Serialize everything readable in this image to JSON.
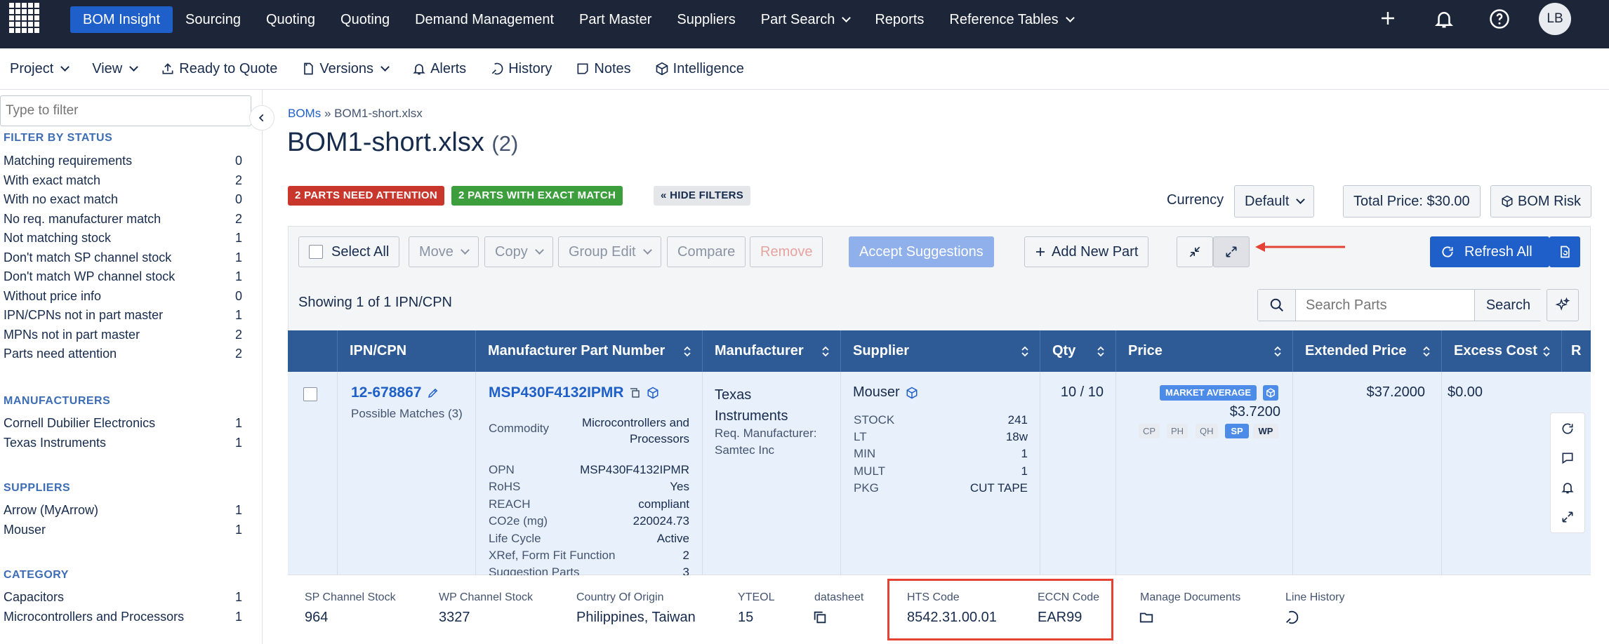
{
  "topnav": {
    "items": [
      "BOM Insight",
      "Sourcing",
      "Quoting",
      "Quoting",
      "Demand Management",
      "Part Master",
      "Suppliers",
      "Part Search",
      "Reports",
      "Reference Tables"
    ],
    "avatar": "LB"
  },
  "subnav": {
    "project": "Project",
    "view": "View",
    "ready": "Ready to Quote",
    "versions": "Versions",
    "alerts": "Alerts",
    "history": "History",
    "notes": "Notes",
    "intelligence": "Intelligence"
  },
  "sidebar": {
    "filter_placeholder": "Type to filter",
    "status_heading": "FILTER BY STATUS",
    "status": [
      {
        "label": "Matching requirements",
        "count": "0"
      },
      {
        "label": "With exact match",
        "count": "2"
      },
      {
        "label": "With no exact match",
        "count": "0"
      },
      {
        "label": "No req. manufacturer match",
        "count": "2"
      },
      {
        "label": "Not matching stock",
        "count": "1"
      },
      {
        "label": "Don't match SP channel stock",
        "count": "1"
      },
      {
        "label": "Don't match WP channel stock",
        "count": "1"
      },
      {
        "label": "Without price info",
        "count": "0"
      },
      {
        "label": "IPN/CPNs not in part master",
        "count": "1"
      },
      {
        "label": "MPNs not in part master",
        "count": "2"
      },
      {
        "label": "Parts need attention",
        "count": "2"
      }
    ],
    "manufacturers_heading": "MANUFACTURERS",
    "manufacturers": [
      {
        "label": "Cornell Dubilier Electronics",
        "count": "1"
      },
      {
        "label": "Texas Instruments",
        "count": "1"
      }
    ],
    "suppliers_heading": "SUPPLIERS",
    "suppliers": [
      {
        "label": "Arrow (MyArrow)",
        "count": "1"
      },
      {
        "label": "Mouser",
        "count": "1"
      }
    ],
    "category_heading": "CATEGORY",
    "category": [
      {
        "label": "Capacitors",
        "count": "1"
      },
      {
        "label": "Microcontrollers and Processors",
        "count": "1"
      }
    ]
  },
  "page": {
    "breadcrumb_link": "BOMs",
    "breadcrumb_sep": "»",
    "breadcrumb_current": "BOM1-short.xlsx",
    "title": "BOM1-short.xlsx",
    "count": "(2)",
    "badge_attention": "2 PARTS NEED ATTENTION",
    "badge_match": "2 PARTS WITH EXACT MATCH",
    "hide_filters": "« HIDE FILTERS",
    "currency_label": "Currency",
    "currency_value": "Default",
    "total_price": "Total Price: $30.00",
    "bom_risk": "BOM Risk"
  },
  "toolbar": {
    "select_all": "Select All",
    "move": "Move",
    "copy": "Copy",
    "group_edit": "Group Edit",
    "compare": "Compare",
    "remove": "Remove",
    "accept": "Accept Suggestions",
    "add_part": "Add New Part",
    "refresh_all": "Refresh All",
    "showing": "Showing 1 of 1 IPN/CPN",
    "search_placeholder": "Search Parts",
    "search_btn": "Search"
  },
  "colors": {
    "nav_bg": "#1d2638",
    "accent": "#1f5fc9",
    "header_bg": "#2e5b96",
    "attention": "#c9372c",
    "match": "#3c9e3d",
    "highlight": "#e34234"
  },
  "table": {
    "headers": [
      "IPN/CPN",
      "Manufacturer Part Number",
      "Manufacturer",
      "Supplier",
      "Qty",
      "Price",
      "Extended Price",
      "Excess Cost",
      "R"
    ],
    "row": {
      "ipn": "12-678867",
      "possible": "Possible Matches (3)",
      "mpn": "MSP430F4132IPMR",
      "commodity_label": "Commodity",
      "commodity_value": "Microcontrollers and Processors",
      "specs": [
        {
          "k": "OPN",
          "v": "MSP430F4132IPMR"
        },
        {
          "k": "RoHS",
          "v": "Yes"
        },
        {
          "k": "REACH",
          "v": "compliant"
        },
        {
          "k": "CO2e (mg)",
          "v": "220024.73"
        },
        {
          "k": "Life Cycle",
          "v": "Active"
        },
        {
          "k": "XRef, Form Fit Function",
          "v": "2"
        },
        {
          "k": "Suggestion Parts",
          "v": "3"
        }
      ],
      "manufacturer": "Texas Instruments",
      "req_mfr_label": "Req. Manufacturer:",
      "req_mfr": "Samtec Inc",
      "supplier": "Mouser",
      "supplier_specs": [
        {
          "k": "STOCK",
          "v": "241"
        },
        {
          "k": "LT",
          "v": "18w"
        },
        {
          "k": "MIN",
          "v": "1"
        },
        {
          "k": "MULT",
          "v": "1"
        },
        {
          "k": "PKG",
          "v": "CUT TAPE"
        }
      ],
      "qty": "10 / 10",
      "market_avg": "MARKET AVERAGE",
      "price": "$3.7200",
      "channels": [
        "CP",
        "PH",
        "QH",
        "SP",
        "WP"
      ],
      "extended": "$37.2000",
      "excess": "$0.00"
    },
    "details": [
      {
        "label": "SP Channel Stock",
        "value": "964"
      },
      {
        "label": "WP Channel Stock",
        "value": "3327"
      },
      {
        "label": "Country Of Origin",
        "value": "Philippines, Taiwan"
      },
      {
        "label": "YTEOL",
        "value": "15"
      },
      {
        "label": "datasheet",
        "value": ""
      },
      {
        "label": "HTS Code",
        "value": "8542.31.00.01"
      },
      {
        "label": "ECCN Code",
        "value": "EAR99"
      },
      {
        "label": "Manage Documents",
        "value": ""
      },
      {
        "label": "Line History",
        "value": ""
      }
    ]
  }
}
